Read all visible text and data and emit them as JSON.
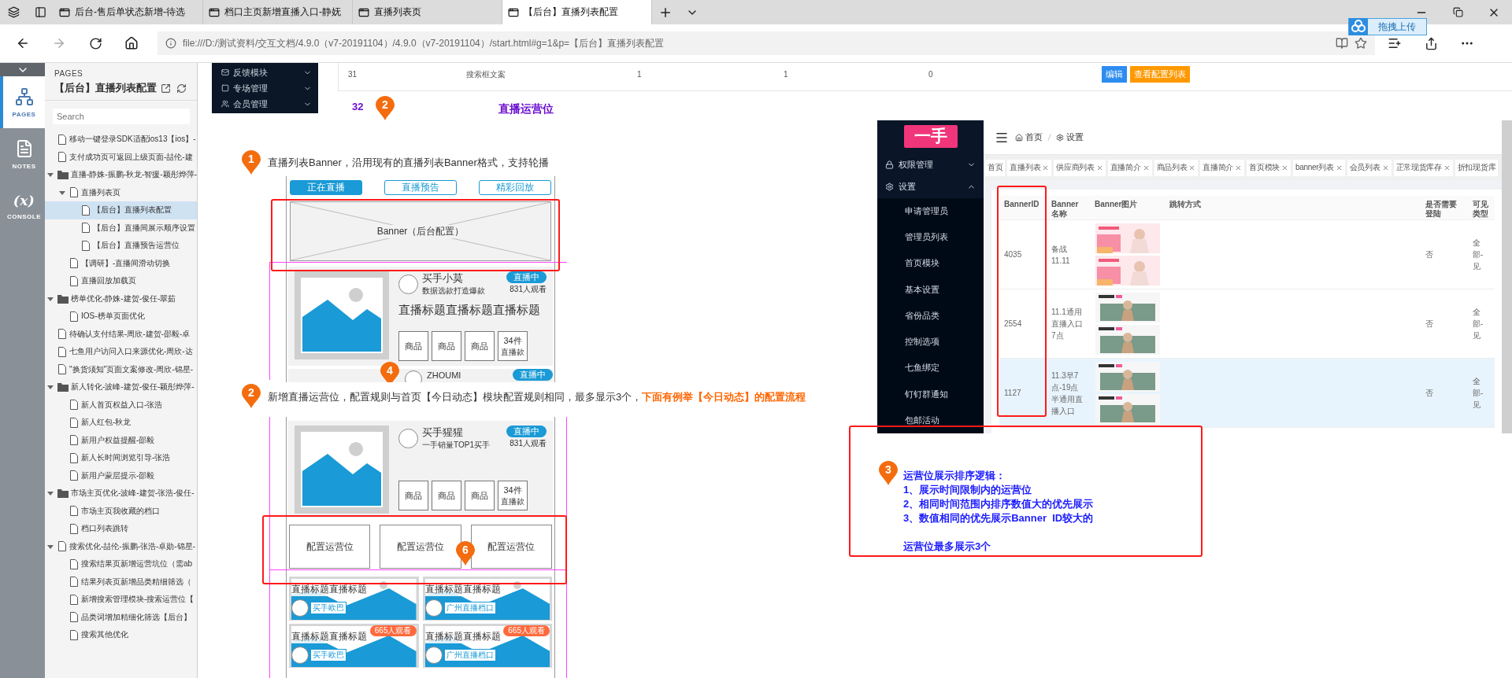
{
  "browser": {
    "tabs": [
      {
        "title": "后台-售后单状态新增-待选",
        "selected": false
      },
      {
        "title": "档口主页新增直播入口-静妩",
        "selected": false
      },
      {
        "title": "直播列表页",
        "selected": false
      },
      {
        "title": "【后台】直播列表配置",
        "selected": true
      }
    ],
    "address": "file:///D:/测试资料/交互文档/4.9.0（v7-20191104）/4.9.0（v7-20191104）/start.html#g=1&p=【后台】直播列表配置",
    "upload_button": "拖拽上传"
  },
  "rail": {
    "items": [
      {
        "label": "PAGES",
        "kind": "pages",
        "selected": true
      },
      {
        "label": "NOTES",
        "kind": "notes",
        "selected": false
      },
      {
        "label": "CONSOLE",
        "kind": "console",
        "selected": false
      }
    ],
    "console_symbol": "(x)"
  },
  "pages_panel": {
    "heading": "PAGES",
    "title": "【后台】直播列表配置",
    "search": {
      "placeholder": "Search"
    },
    "tree": [
      {
        "label": "移动一键登录SDK适配ios13【ios】-",
        "kind": "page",
        "selected": false
      },
      {
        "label": "支付成功页可返回上级页面-喆伦-建",
        "kind": "page",
        "selected": false
      },
      {
        "label": "直播-静姝-振鹏-秋龙-智援-颖彤烨萍-",
        "kind": "folder",
        "selected": false,
        "expanded": true,
        "children": [
          {
            "label": "直播列表页",
            "kind": "page",
            "selected": false,
            "expanded": true,
            "children": [
              {
                "label": "【后台】直播列表配置",
                "kind": "page",
                "selected": true
              },
              {
                "label": "【后台】直播间展示顺序设置",
                "kind": "page",
                "selected": false
              },
              {
                "label": "【后台】直播预告运营位",
                "kind": "page",
                "selected": false
              }
            ]
          },
          {
            "label": "【调研】-直播间滑动切换",
            "kind": "page",
            "selected": false
          },
          {
            "label": "直播回放加载页",
            "kind": "page",
            "selected": false
          }
        ]
      },
      {
        "label": "榜单优化-静姝-建贺-俊任-翠茹",
        "kind": "folder",
        "selected": false,
        "expanded": true,
        "children": [
          {
            "label": "IOS-榜单页面优化",
            "kind": "page",
            "selected": false
          }
        ]
      },
      {
        "label": "待确认支付结果-周欣-建贺-邵毅-卓",
        "kind": "page",
        "selected": false
      },
      {
        "label": "七鱼用户访问入口来源优化-周欣-达",
        "kind": "page",
        "selected": false
      },
      {
        "label": "\"换货须知\"页面文案修改-周欣-锦星-",
        "kind": "page",
        "selected": false
      },
      {
        "label": "新人转化-波峰-建贺-俊任-颖彤烨萍-",
        "kind": "folder",
        "selected": false,
        "expanded": true,
        "children": [
          {
            "label": "新人首页权益入口-张浩",
            "kind": "page",
            "selected": false
          },
          {
            "label": "新人红包-秋龙",
            "kind": "page",
            "selected": false
          },
          {
            "label": "新用户权益提醒-邵毅",
            "kind": "page",
            "selected": false
          },
          {
            "label": "新人长时间浏览引导-张浩",
            "kind": "page",
            "selected": false
          },
          {
            "label": "新用户蒙层提示-邵毅",
            "kind": "page",
            "selected": false
          }
        ]
      },
      {
        "label": "市场主页优化-波峰-建贺-张浩-俊任-",
        "kind": "folder",
        "selected": false,
        "expanded": true,
        "children": [
          {
            "label": "市场主页我收藏的档口",
            "kind": "page",
            "selected": false
          },
          {
            "label": "档口列表跳转",
            "kind": "page",
            "selected": false
          }
        ]
      },
      {
        "label": "搜索优化-喆伦-振鹏-张浩-卓勋-锦星-",
        "kind": "page",
        "selected": false,
        "expanded": true,
        "children": [
          {
            "label": "搜索结果页新增运营坑位（需ab",
            "kind": "page",
            "selected": false
          },
          {
            "label": "结果列表页新增品类精细筛选（",
            "kind": "page",
            "selected": false
          },
          {
            "label": "新增搜索管理模块-搜索运营位【",
            "kind": "page",
            "selected": false
          },
          {
            "label": "品类词增加精细化筛选【后台】",
            "kind": "page",
            "selected": false
          },
          {
            "label": "搜索其他优化",
            "kind": "page",
            "selected": false
          }
        ]
      }
    ]
  },
  "canvas": {
    "top_fragment": {
      "menu": [
        "反馈模块",
        "专场管理",
        "会员管理"
      ],
      "row": [
        "31",
        "搜索框文案",
        "1",
        "1",
        "0"
      ],
      "actions": [
        {
          "label": "编辑",
          "kind": "primary"
        },
        {
          "label": "查看配置列表",
          "kind": "warning"
        }
      ]
    },
    "section": {
      "number": "32",
      "marker": "2",
      "title": "直播运营位"
    },
    "note_1": {
      "marker": "1",
      "text": "直播列表Banner，沿用现有的直播列表Banner格式，支持轮播"
    },
    "wireframe_1": {
      "tabs": [
        {
          "label": "正在直播",
          "selected": true
        },
        {
          "label": "直播预告",
          "selected": false
        },
        {
          "label": "精彩回放",
          "selected": false
        }
      ],
      "banner": "Banner（后台配置）",
      "card": {
        "name": "买手小莫",
        "subtitle": "数据选款打造爆款",
        "badge": "直播中",
        "viewers": "831人观看",
        "title": "直播标题直播标题直播标题",
        "products": [
          "商品",
          "商品",
          "商品"
        ],
        "count": "34件",
        "count_label": "直播款"
      },
      "next_card": {
        "marker": "4",
        "name": "ZHOUMI",
        "badge": "直播中"
      }
    },
    "note_2": {
      "marker": "2",
      "text": "新增直播运营位，配置规则与首页【今日动态】模块配置规则相同，最多显示3个，",
      "highlight": "下面有例举【今日动态】的配置流程"
    },
    "wireframe_2": {
      "card": {
        "name": "买手猩猩",
        "subtitle": "一手销量TOP1买手",
        "badge": "直播中",
        "viewers": "831人观看",
        "products": [
          "商品",
          "商品",
          "商品"
        ],
        "count": "34件",
        "count_label": "直播款"
      },
      "slots": [
        "配置运营位",
        "配置运营位",
        "配置运营位"
      ],
      "slot_marker": "6",
      "tiles": [
        {
          "title": "直播标题直播标题",
          "tag": "买手欧巴"
        },
        {
          "title": "直播标题直播标题",
          "tag": "广州直播档口"
        },
        {
          "title": "直播标题直播标题",
          "tag": "买手欧巴",
          "viewers": "665人观看"
        },
        {
          "title": "直播标题直播标题",
          "tag": "广州直播档口",
          "viewers": "665人观看"
        }
      ]
    },
    "admin": {
      "logo": "一手",
      "menu": [
        {
          "label": "权限管理",
          "expanded": false
        },
        {
          "label": "设置",
          "expanded": true
        }
      ],
      "submenu": [
        "申请管理员",
        "管理员列表",
        "首页模块",
        "基本设置",
        "省份品类",
        "控制选项",
        "七鱼绑定",
        "钉钉群通知",
        "包邮活动"
      ],
      "breadcrumb": [
        "首页",
        "设置"
      ],
      "tags": [
        {
          "label": "首页",
          "closable": false
        },
        {
          "label": "直播列表",
          "closable": true
        },
        {
          "label": "供应商列表",
          "closable": true
        },
        {
          "label": "直播简介",
          "closable": true
        },
        {
          "label": "商品列表",
          "closable": true
        },
        {
          "label": "直播简介",
          "closable": true
        },
        {
          "label": "首页模块",
          "closable": true
        },
        {
          "label": "banner列表",
          "closable": true
        },
        {
          "label": "会员列表",
          "closable": true
        },
        {
          "label": "正常现货库存",
          "closable": true
        },
        {
          "label": "折扣现货库",
          "closable": false
        }
      ],
      "columns": [
        "BannerID",
        "Banner名称",
        "Banner图片",
        "跳转方式",
        "是否需要登陆",
        "可见类型"
      ],
      "rows": [
        {
          "id": "4035",
          "name": "备战11.11",
          "login": "否",
          "visible": "全部-见",
          "highlighted": false
        },
        {
          "id": "2554",
          "name": "11.1通用直播入口7点",
          "login": "否",
          "visible": "全部-见",
          "highlighted": false
        },
        {
          "id": "1127",
          "name": "11.3早7点-19点半通用直播入口",
          "login": "否",
          "visible": "全部-见",
          "highlighted": true
        }
      ]
    },
    "note_3": {
      "marker": "3",
      "lines": [
        "运营位展示排序逻辑：",
        "1、展示时间限制内的运营位",
        "2、相同时间范围内排序数值大的优先展示",
        "3、数值相同的优先展示Banner  ID较大的"
      ],
      "summary": "运营位最多展示3个"
    }
  }
}
